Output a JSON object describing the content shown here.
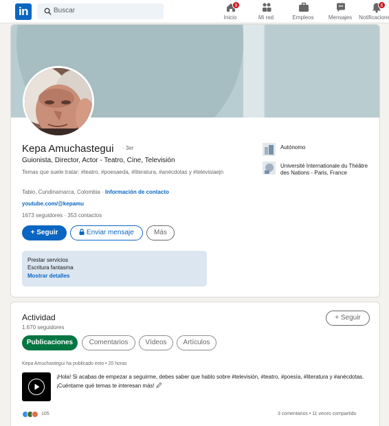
{
  "nav": {
    "logo_text": "in",
    "search_placeholder": "Buscar",
    "items": [
      {
        "label": "Inicio",
        "icon": "home-icon",
        "badge": "9"
      },
      {
        "label": "Mi red",
        "icon": "network-icon",
        "badge": ""
      },
      {
        "label": "Empleos",
        "icon": "briefcase-icon",
        "badge": ""
      },
      {
        "label": "Mensajes",
        "icon": "chat-icon",
        "badge": ""
      },
      {
        "label": "Notificaciones",
        "icon": "bell-icon",
        "badge": "6"
      }
    ]
  },
  "profile": {
    "name": "Kepa Amuchastegui",
    "degree": "· 3er",
    "headline": "Guionista, Director, Actor - Teatro, Cine, Televisión",
    "topics": "Temas que suele tratar: #teatro, #poesaeda, #literatura, #anécdotas y #televisiaejn",
    "location": "Tabio, Cundinamarca, Colombia ·",
    "contact_link": "Información de contacto",
    "website": "youtube.com/@kepamu",
    "followers": "1673 seguidores",
    "connections": "· 353 contactos",
    "follow_button": "+ Seguir",
    "message_button": "Enviar mensaje",
    "more_button": "Más",
    "services": {
      "line1": "Prestar servicios",
      "line2": "Escritura fantasma",
      "link": "Mostrar detalles"
    },
    "experience": [
      {
        "name": "Autónomo"
      },
      {
        "name": "Université Internationale du Théâtre des Nations - Paris, France"
      }
    ]
  },
  "activity": {
    "title": "Actividad",
    "followers": "1.670 seguidores",
    "follow_button": "+ Seguir",
    "tabs": [
      "Publicaciones",
      "Comentarios",
      "Vídeos",
      "Artículos"
    ],
    "post": {
      "meta": "Kepa Amuchastegui ha publicado esto • 20 horas",
      "text": "¡Hola! Si acabas de empezar a seguirme, debes saber que hablo sobre #televisión, #teatro, #poesía, #literatura y #anécdotas. ¡Cuéntame qué temas te interesan más! 🖉",
      "reactions_count": "105",
      "stats": "3 comentarios • 11 veces compartido"
    }
  },
  "colors": {
    "brand": "#0a66c2",
    "active_tab": "#057642",
    "badge": "#cc1016"
  }
}
